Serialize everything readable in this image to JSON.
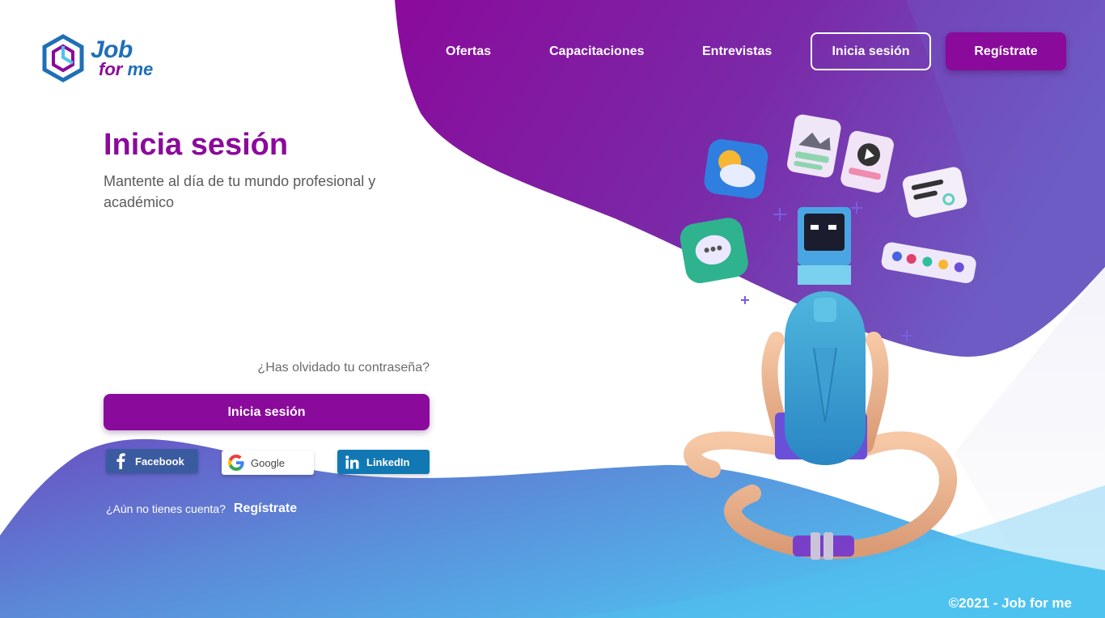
{
  "brand": {
    "name_line1": "Job",
    "name_for": "for",
    "name_me": "me"
  },
  "nav": {
    "items": [
      {
        "label": "Ofertas"
      },
      {
        "label": "Capacitaciones"
      },
      {
        "label": "Entrevistas"
      }
    ],
    "login_label": "Inicia sesión",
    "register_label": "Regístrate"
  },
  "form": {
    "title": "Inicia sesión",
    "subtitle": "Mantente al día de tu mundo profesional y académico",
    "forgot_label": "¿Has olvidado tu contraseña?",
    "submit_label": "Inicia sesión",
    "social": {
      "facebook": "Facebook",
      "google": "Google",
      "linkedin": "LinkedIn"
    },
    "no_account_text": "¿Aún no tienes cuenta?",
    "register_link": "Regístrate"
  },
  "footer": {
    "copyright": "©2021 - Job for me"
  },
  "colors": {
    "primary": "#8a0a9b",
    "brand_blue": "#1f6fb8",
    "gradient_blue": "#4fc3f0"
  },
  "illustration": {
    "icons": [
      "weather-app-icon",
      "image-card-icon",
      "video-card-icon",
      "chat-bubble-icon",
      "robot-monitor-icon",
      "toggle-card-icon",
      "color-palette-icon",
      "meditating-robot"
    ]
  }
}
